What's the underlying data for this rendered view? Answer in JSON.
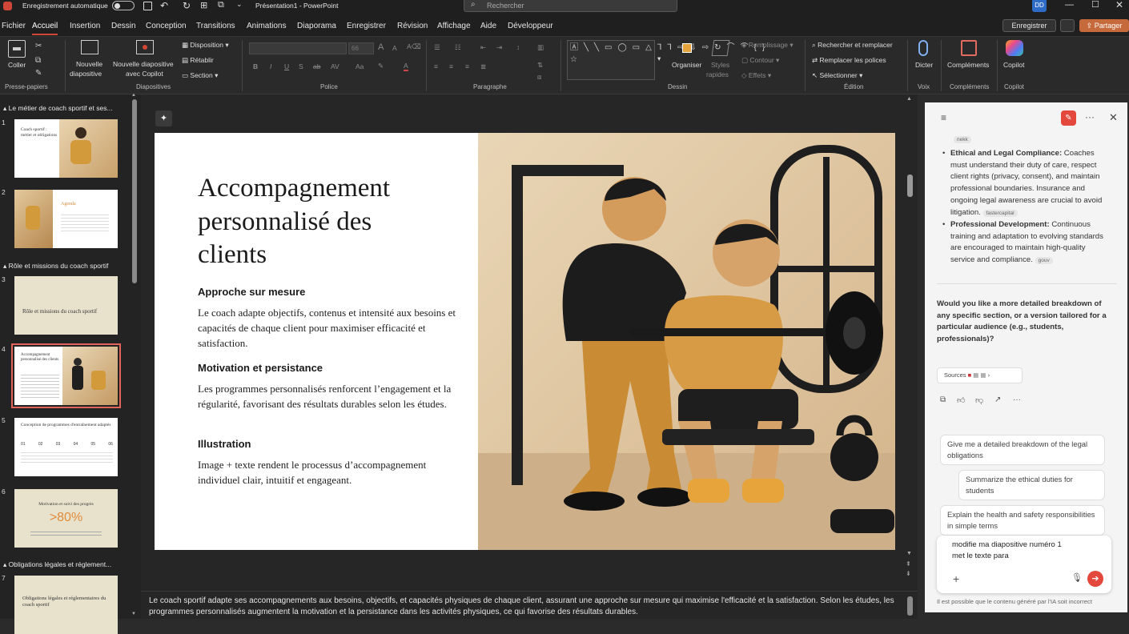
{
  "titlebar": {
    "autosave": "Enregistrement automatique",
    "doc_title": "Présentation1 - PowerPoint",
    "search_placeholder": "Rechercher",
    "user_initials": "DD"
  },
  "menu": {
    "items": [
      "Fichier",
      "Accueil",
      "Insertion",
      "Dessin",
      "Conception",
      "Transitions",
      "Animations",
      "Diaporama",
      "Enregistrer",
      "Révision",
      "Affichage",
      "Aide",
      "Développeur"
    ],
    "save_button": "Enregistrer",
    "share_button": "Partager"
  },
  "ribbon": {
    "clipboard": {
      "paste": "Coller",
      "label": "Presse-papiers"
    },
    "slides": {
      "new_slide": [
        "Nouvelle",
        "diapositive"
      ],
      "new_copilot": [
        "Nouvelle diapositive",
        "avec Copilot"
      ],
      "layout": "Disposition",
      "reset": "Rétablir",
      "section": "Section",
      "label": "Diapositives"
    },
    "font": {
      "size": "66",
      "label": "Police"
    },
    "paragraph": {
      "label": "Paragraphe"
    },
    "drawing": {
      "arrange": "Organiser",
      "styles": [
        "Styles",
        "rapides"
      ],
      "fill": "Remplissage",
      "outline": "Contour",
      "effects": "Effets",
      "label": "Dessin"
    },
    "editing": {
      "find_replace": "Rechercher et remplacer",
      "replace_fonts": "Remplacer les polices",
      "select": "Sélectionner",
      "label": "Édition"
    },
    "voice": {
      "dictate": "Dicter",
      "label": "Voix"
    },
    "addins": {
      "addins": "Compléments",
      "label": "Compléments"
    },
    "copilot": {
      "copilot": "Copilot",
      "label": "Copilot"
    }
  },
  "thumbs": {
    "sections": [
      "Le métier de coach sportif et ses...",
      "Rôle et missions du coach sportif",
      "Obligations légales et réglement..."
    ],
    "slides": [
      {
        "num": "1",
        "text": "Coach sportif : métier et obligations"
      },
      {
        "num": "2",
        "text": "Agenda"
      },
      {
        "num": "3",
        "text": "Rôle et missions du coach sportif"
      },
      {
        "num": "4",
        "text": "Accompagnement personnalisé des clients"
      },
      {
        "num": "5",
        "text": "Conception de programmes d'entraînement adaptés",
        "cols": [
          "01",
          "02",
          "03",
          "04",
          "05",
          "06"
        ]
      },
      {
        "num": "6",
        "text": "Motivation et suivi des progrès",
        "big": ">80%"
      },
      {
        "num": "7",
        "text": "Obligations légales et réglementaires du coach sportif"
      }
    ]
  },
  "slide": {
    "title": "Accompagnement personnalisé des clients",
    "sections": [
      {
        "heading": "Approche sur mesure",
        "body": "Le coach adapte objectifs, contenus et intensité aux besoins et capacités de chaque client pour maximiser efficacité et satisfaction."
      },
      {
        "heading": "Motivation et persistance",
        "body": "Les programmes personnalisés renforcent l’engagement et la régularité, favorisant des résultats durables selon les études."
      },
      {
        "heading": "Illustration",
        "body": "Image + texte rendent le processus d’accompagnement individuel clair, intuitif et engageant."
      }
    ]
  },
  "notes": {
    "text": "Le coach sportif adapte ses accompagnements aux besoins, objectifs, et capacités physiques de chaque client, assurant une approche sur mesure qui maximise l'efficacité et la satisfaction. Selon les études, les programmes personnalisés augmentent la motivation et la persistance dans les activités physiques, ce qui favorise des résultats durables."
  },
  "copilot": {
    "top_tag": "nekk",
    "bullets": [
      {
        "bold": "Ethical and Legal Compliance:",
        "text": " Coaches must understand their duty of care, respect client rights (privacy, consent), and maintain professional boundaries. Insurance and ongoing legal awareness are crucial to avoid litigation.",
        "tag": "fastercapital"
      },
      {
        "bold": "Professional Development:",
        "text": " Continuous training and adaptation to evolving standards are encouraged to maintain high-quality service and compliance.",
        "tag": "gouv"
      }
    ],
    "question": "Would you like a more detailed breakdown of any specific section, or a version tailored for a particular audience (e.g., students, professionals)?",
    "sources_label": "Sources",
    "suggestions": [
      "Give me a detailed breakdown of the legal obligations",
      "Summarize the ethical duties for students",
      "Explain the health and safety responsibilities in simple terms"
    ],
    "input_text": "modifie ma diapositive numéro 1 met le texte para",
    "disclaimer": "Il est possible que le contenu généré par l'IA soit incorrect"
  }
}
